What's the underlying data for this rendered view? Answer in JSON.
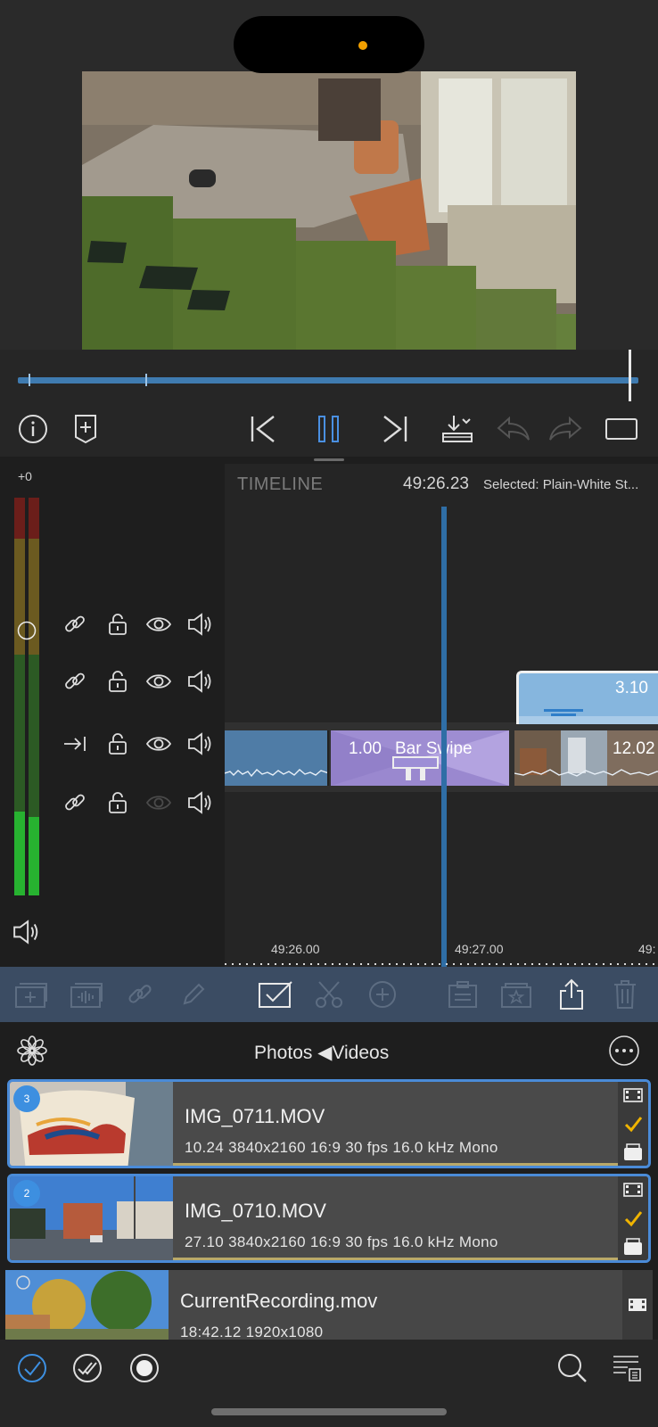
{
  "preview": {
    "scrubber_progress": 0.985
  },
  "toolbar": {
    "icons": [
      "info-icon",
      "add-marker-icon",
      "skip-back-icon",
      "pause-icon",
      "skip-forward-icon",
      "export-icon",
      "undo-icon",
      "redo-icon",
      "aspect-ratio-icon"
    ]
  },
  "audio_panel": {
    "gain_label": "+0",
    "meter_level": 0.21,
    "tracks": [
      {
        "link_icon": "link-icon",
        "lock": "unlocked",
        "visible": true,
        "audio": "speaker-icon"
      },
      {
        "link_icon": "link-icon",
        "lock": "unlocked",
        "visible": true,
        "audio": "speaker-icon"
      },
      {
        "link_icon": "arrow-right-icon",
        "lock": "unlocked",
        "visible": true,
        "audio": "speaker-icon"
      },
      {
        "link_icon": "link-icon",
        "lock": "unlocked",
        "visible": false,
        "audio": "speaker-icon"
      }
    ]
  },
  "timeline": {
    "title": "TIMELINE",
    "timecode": "49:26.23",
    "selected": "Selected: Plain-White St...",
    "clips": {
      "transition_duration": "1.00",
      "transition_name": "Bar Swipe",
      "title_clip_duration": "3.10",
      "video_clip_duration": "12.02"
    },
    "ruler": [
      "49:26.00",
      "49:27.00",
      "49:"
    ]
  },
  "library": {
    "title": "Photos ◀Videos",
    "items": [
      {
        "badge": "3",
        "name": "IMG_0711.MOV",
        "meta": "10.24  3840x2160  16:9  30 fps  16.0 kHz  Mono",
        "selected": true
      },
      {
        "badge": "2",
        "name": "IMG_0710.MOV",
        "meta": "27.10  3840x2160  16:9  30 fps  16.0 kHz  Mono",
        "selected": true
      },
      {
        "badge": "",
        "name": "CurrentRecording.mov",
        "meta": "18:42.12  1920x1080",
        "selected": false
      }
    ]
  },
  "colors": {
    "accent": "#3d8fe0",
    "timeline_clip": "#4f7ca6",
    "transition": "#9a88cf",
    "edit_bar": "#3b4c63",
    "check": "#f0b400",
    "live_dot": "#f2a000"
  }
}
